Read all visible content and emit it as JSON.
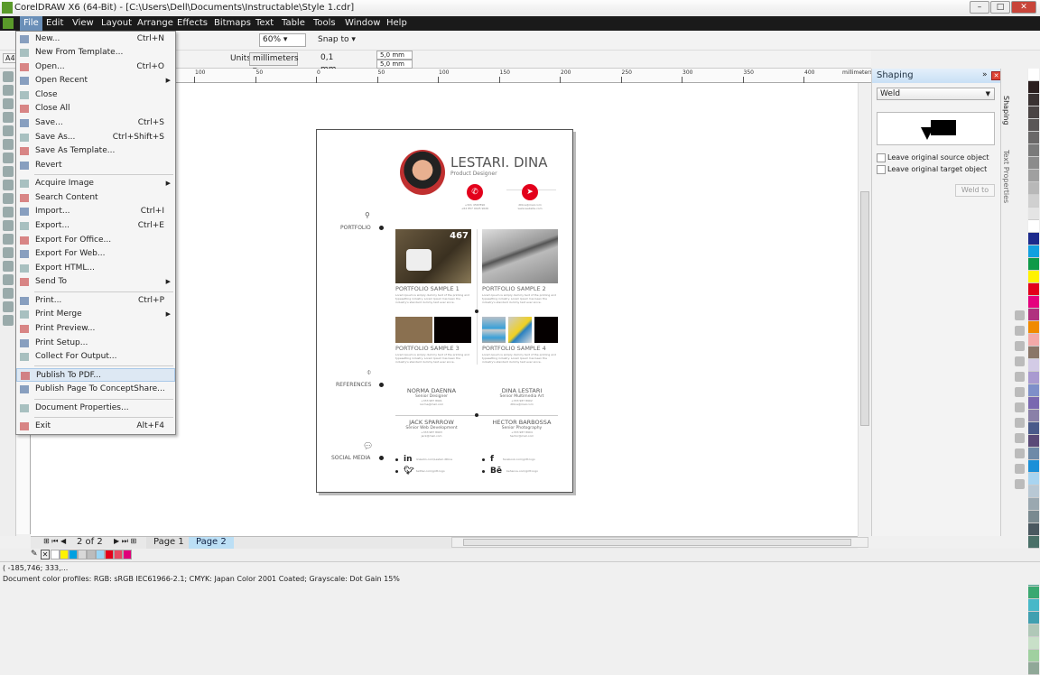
{
  "window": {
    "title": "CorelDRAW X6 (64-Bit) - [C:\\Users\\Dell\\Documents\\Instructable\\Style 1.cdr]"
  },
  "menubar": [
    "File",
    "Edit",
    "View",
    "Layout",
    "Arrange",
    "Effects",
    "Bitmaps",
    "Text",
    "Table",
    "Tools",
    "Window",
    "Help"
  ],
  "toolbar": {
    "zoom": "60%",
    "snap_to": "Snap to",
    "paper": "A4",
    "units_label": "Units:",
    "units": "millimeters",
    "nudge": "0,1 mm",
    "dup_x": "5,0 mm",
    "dup_y": "5,0 mm"
  },
  "ruler": {
    "unit": "millimeters",
    "labels": [
      "100",
      "50",
      "0",
      "50",
      "100",
      "150",
      "200",
      "250",
      "300",
      "350",
      "400"
    ]
  },
  "file_menu": [
    {
      "label": "New...",
      "shortcut": "Ctrl+N"
    },
    {
      "label": "New From Template..."
    },
    {
      "label": "Open...",
      "shortcut": "Ctrl+O"
    },
    {
      "label": "Open Recent",
      "submenu": true
    },
    {
      "label": "Close"
    },
    {
      "label": "Close All"
    },
    {
      "label": "Save...",
      "shortcut": "Ctrl+S"
    },
    {
      "label": "Save As...",
      "shortcut": "Ctrl+Shift+S"
    },
    {
      "label": "Save As Template..."
    },
    {
      "label": "Revert"
    },
    {
      "label": "Acquire Image",
      "submenu": true,
      "sep": true
    },
    {
      "label": "Search Content"
    },
    {
      "label": "Import...",
      "shortcut": "Ctrl+I"
    },
    {
      "label": "Export...",
      "shortcut": "Ctrl+E"
    },
    {
      "label": "Export For Office..."
    },
    {
      "label": "Export For Web..."
    },
    {
      "label": "Export HTML..."
    },
    {
      "label": "Send To",
      "submenu": true
    },
    {
      "label": "Print...",
      "shortcut": "Ctrl+P",
      "sep": true
    },
    {
      "label": "Print Merge",
      "submenu": true
    },
    {
      "label": "Print Preview..."
    },
    {
      "label": "Print Setup..."
    },
    {
      "label": "Collect For Output..."
    },
    {
      "label": "Publish To PDF...",
      "sep": true,
      "highlighted": true
    },
    {
      "label": "Publish Page To ConceptShare..."
    },
    {
      "label": "Document Properties...",
      "sep": true
    },
    {
      "label": "Exit",
      "shortcut": "Alt+F4",
      "sep": true
    }
  ],
  "document": {
    "name": "LESTARI. DINA",
    "role": "Product Designer",
    "phone": "+321 4567890\n+62 857 9025 9026",
    "email": "dDina@mail.com\nwww.website.com",
    "sections": {
      "portfolio": "PORTFOLIO",
      "references": "REFERENCES",
      "social": "SOCIAL MEDIA"
    },
    "photo_number": "467",
    "portfolio": [
      {
        "title": "PORTFOLIO SAMPLE 1",
        "text": "Lorem Ipsum is simply dummy text of the printing and typesetting industry. Lorem Ipsum has been the industry's standard dummy text ever since."
      },
      {
        "title": "PORTFOLIO SAMPLE 2",
        "text": "Lorem Ipsum is simply dummy text of the printing and typesetting industry. Lorem Ipsum has been the industry's standard dummy text ever since."
      },
      {
        "title": "PORTFOLIO SAMPLE 3",
        "text": "Lorem Ipsum is simply dummy text of the printing and typesetting industry. Lorem Ipsum has been the industry's standard dummy text ever since."
      },
      {
        "title": "PORTFOLIO SAMPLE 4",
        "text": "Lorem Ipsum is simply dummy text of the printing and typesetting industry. Lorem Ipsum has been the industry's standard dummy text ever since."
      }
    ],
    "references": [
      {
        "name": "NORMA DAENNA",
        "role": "Senior Designer",
        "phone": "+333 987 8901",
        "email": "norma@mail.com"
      },
      {
        "name": "DINA LESTARI",
        "role": "Senior Multimedia Art",
        "phone": "+333 987 8902",
        "email": "dDina@mail.com"
      },
      {
        "name": "JACK SPARROW",
        "role": "Senior Web Development",
        "phone": "+333 987 8903",
        "email": "jack@mail.com"
      },
      {
        "name": "HECTOR BARBOSSA",
        "role": "Senior Photography",
        "phone": "+333 987 8904",
        "email": "hector@mail.com"
      }
    ],
    "social": [
      {
        "icon": "in",
        "text": "linkedin.com/Lestari.dDina"
      },
      {
        "icon": "f",
        "text": "facebook.com/gritt.logo"
      },
      {
        "icon": "twitter",
        "text": "twitter.com/gritt.logo"
      },
      {
        "icon": "Bē",
        "text": "behance.com/gritt.logo"
      }
    ],
    "accent": "#e3001b"
  },
  "docker": {
    "title": "Shaping",
    "mode": "Weld",
    "leave_source": "Leave original source object",
    "leave_target": "Leave original target object",
    "apply": "Weld to",
    "tabs": [
      "Shaping",
      "Text Properties"
    ]
  },
  "pages": {
    "counter": "2 of 2",
    "tabs": [
      "Page 1",
      "Page 2"
    ],
    "active": "Page 2"
  },
  "status": {
    "coords": "( -185,746; 333,...",
    "profiles": "Document color profiles: RGB: sRGB IEC61966-2.1; CMYK: Japan Color 2001 Coated; Grayscale: Dot Gain 15%"
  },
  "doc_palette": [
    "#ffffff",
    "#fff200",
    "#00a0e0",
    "#d8d8d8",
    "#bcbcbc",
    "#99d5f5",
    "#e3001b",
    "#e84860",
    "#e0007a"
  ],
  "palette": [
    "#ffffff",
    "#2a1e1e",
    "#3a3232",
    "#4a4444",
    "#5a5656",
    "#6a6868",
    "#7a7a7a",
    "#8c8c8c",
    "#a0a0a0",
    "#b8b8b8",
    "#d0d0d0",
    "#e4e4e4",
    "#ffffff",
    "#1c2a8c",
    "#12a0e0",
    "#0f9a48",
    "#fff200",
    "#e3001b",
    "#e5007e",
    "#b0327f",
    "#f08a00",
    "#f4a9a8",
    "#8a7668",
    "#d3cbe6",
    "#a99ad0",
    "#7e8fc9",
    "#7a68b0",
    "#8a80a8",
    "#4a5a8a",
    "#5a4a78",
    "#6e8aa8",
    "#1c90d8",
    "#a8d4f0",
    "#b8c8d4",
    "#9aa8b0",
    "#7a8a90",
    "#4a5860",
    "#4a7068",
    "#3a9078",
    "#6aa898",
    "#48a890",
    "#3aa870",
    "#48b8c8",
    "#40a0b0",
    "#b0c8b8",
    "#c8e0c8",
    "#a0d0a0",
    "#90a898"
  ]
}
